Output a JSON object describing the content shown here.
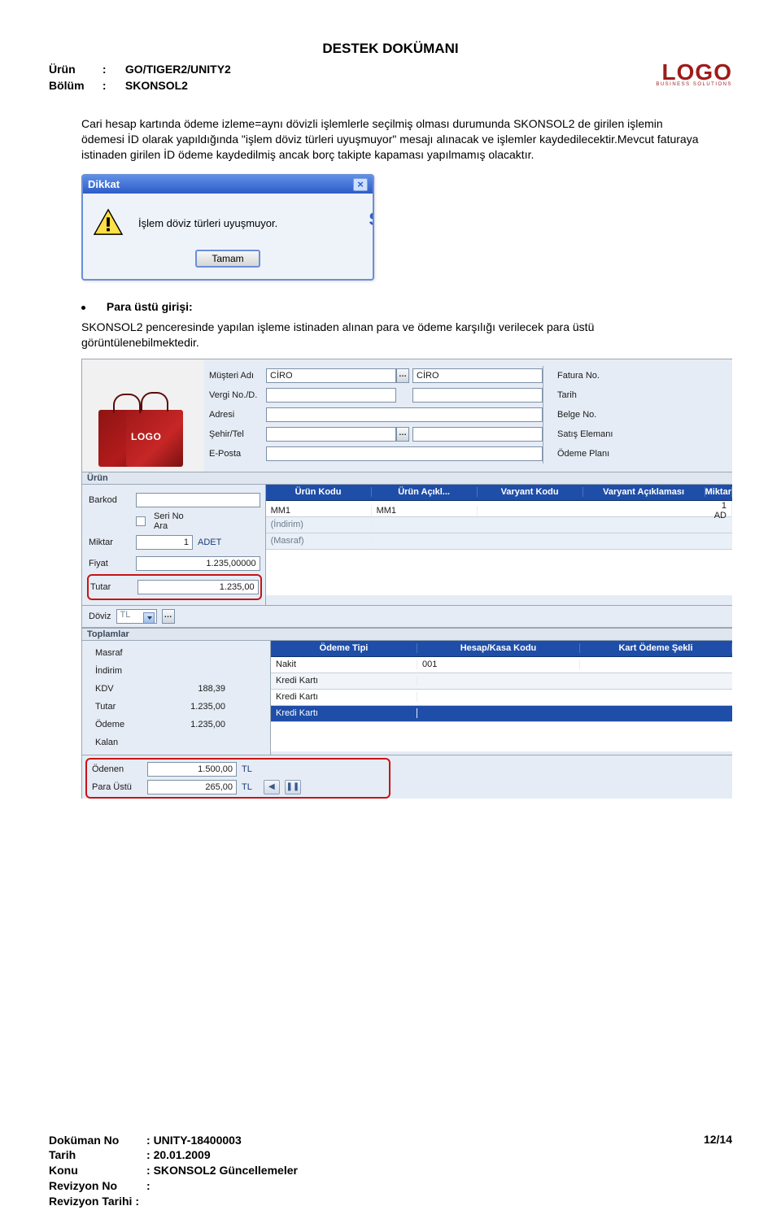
{
  "doc_title": "DESTEK DOKÜMANI",
  "header": {
    "urun_label": "Ürün",
    "urun_value": "GO/TIGER2/UNITY2",
    "bolum_label": "Bölüm",
    "bolum_value": "SKONSOL2",
    "colon": ":"
  },
  "logo": {
    "main": "LOGO",
    "sub": "BUSINESS SOLUTIONS"
  },
  "paragraph1": "Cari hesap kartında ödeme izleme=aynı dövizli işlemlerle seçilmiş olması durumunda SKONSOL2 de girilen işlemin ödemesi İD olarak yapıldığında \"işlem döviz türleri uyuşmuyor\" mesajı alınacak ve işlemler kaydedilecektir.Mevcut faturaya istinaden girilen İD ödeme kaydedilmiş ancak borç takipte kapaması yapılmamış olacaktır.",
  "dialog": {
    "title": "Dikkat",
    "message": "İşlem döviz türleri uyuşmuyor.",
    "ok": "Tamam"
  },
  "bullet": {
    "label": "Para üstü girişi:"
  },
  "paragraph2": "SKONSOL2 penceresinde yapılan işleme istinaden alınan para ve ödeme karşılığı verilecek para üstü görüntülenebilmektedir.",
  "customer": {
    "labels": {
      "musteri": "Müşteri Adı",
      "vergi": "Vergi No./D.",
      "adres": "Adresi",
      "sehir": "Şehir/Tel",
      "eposta": "E-Posta",
      "fatura": "Fatura No.",
      "tarih": "Tarih",
      "belge": "Belge No.",
      "satis": "Satış Elemanı",
      "odeme": "Ödeme Planı"
    },
    "values": {
      "musteri_code": "CİRO",
      "musteri_name": "CİRO"
    }
  },
  "urun_section": {
    "title": "Ürün",
    "barkod": "Barkod",
    "seri": "Seri No Ara",
    "miktar_lbl": "Miktar",
    "miktar_val": "1",
    "miktar_unit": "ADET",
    "fiyat_lbl": "Fiyat",
    "fiyat_val": "1.235,00000",
    "tutar_lbl": "Tutar",
    "tutar_val": "1.235,00",
    "grid_head": [
      "Ürün Kodu",
      "Ürün Açıkl...",
      "Varyant Kodu",
      "Varyant Açıklaması",
      "Miktar"
    ],
    "grid_row": {
      "code": "MM1",
      "desc": "MM1",
      "miktar": "1 AD"
    },
    "sub1": "(İndirim)",
    "sub2": "(Masraf)"
  },
  "doviz": {
    "label": "Döviz",
    "value": "TL"
  },
  "toplam_section": {
    "title": "Toplamlar",
    "rows": [
      {
        "lbl": "Masraf",
        "val": ""
      },
      {
        "lbl": "İndirim",
        "val": ""
      },
      {
        "lbl": "KDV",
        "val": "188,39"
      },
      {
        "lbl": "Tutar",
        "val": "1.235,00"
      },
      {
        "lbl": "Ödeme",
        "val": "1.235,00"
      },
      {
        "lbl": "Kalan",
        "val": ""
      }
    ],
    "pay_head": [
      "Ödeme Tipi",
      "Hesap/Kasa Kodu",
      "Kart Ödeme Şekli"
    ],
    "pay_rows": [
      {
        "tip": "Nakit",
        "hesap": "001",
        "kart": ""
      },
      {
        "tip": "Kredi Kartı",
        "hesap": "",
        "kart": ""
      },
      {
        "tip": "Kredi Kartı",
        "hesap": "",
        "kart": ""
      },
      {
        "tip": "Kredi Kartı",
        "hesap": "",
        "kart": ""
      }
    ]
  },
  "bottom": {
    "odenen_lbl": "Ödenen",
    "odenen_val": "1.500,00",
    "odenen_cur": "TL",
    "para_lbl": "Para Üstü",
    "para_val": "265,00",
    "para_cur": "TL"
  },
  "footer": {
    "dokno_lbl": "Doküman No",
    "dokno_val": "UNITY-18400003",
    "tarih_lbl": "Tarih",
    "tarih_val": "20.01.2009",
    "konu_lbl": "Konu",
    "konu_val": "SKONSOL2 Güncellemeler",
    "revno_lbl": "Revizyon No",
    "revno_val": "",
    "revtar_lbl": "Revizyon Tarihi :",
    "page": "12/14",
    "colon": ":"
  }
}
